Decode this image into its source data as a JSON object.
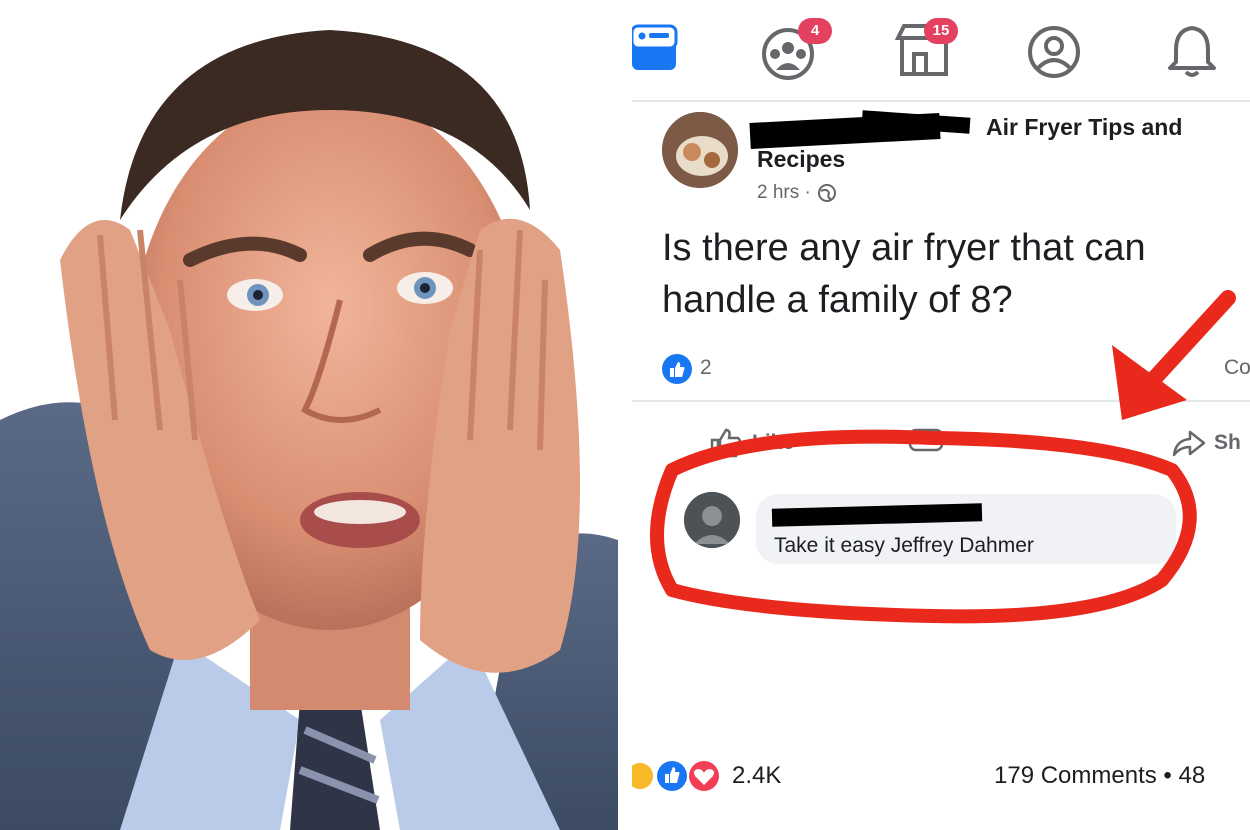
{
  "nav": {
    "groups_badge": "4",
    "marketplace_badge": "15"
  },
  "post": {
    "group_name_line1": "Air Fryer Tips and",
    "group_name_line2": "Recipes",
    "time": "2 hrs ·",
    "text": "Is there any air fryer that can handle a family of 8?",
    "reaction_count": "2",
    "comments_clipped": "Com"
  },
  "actions": {
    "like": "Like",
    "share": "Sh"
  },
  "comment": {
    "text": "Take it easy Jeffrey Dahmer"
  },
  "bottom": {
    "reaction_count": "2.4K",
    "comments": "179 Comments • 48"
  },
  "colors": {
    "fb_blue": "#1877f2",
    "badge_red": "#e4405f",
    "annotation_red": "#e8291c"
  },
  "icons": [
    "menu-icon",
    "groups-icon",
    "marketplace-icon",
    "profile-icon",
    "bell-icon",
    "globe-icon",
    "like-thumb-icon",
    "comment-icon",
    "share-icon",
    "arrow-annotation-icon"
  ]
}
